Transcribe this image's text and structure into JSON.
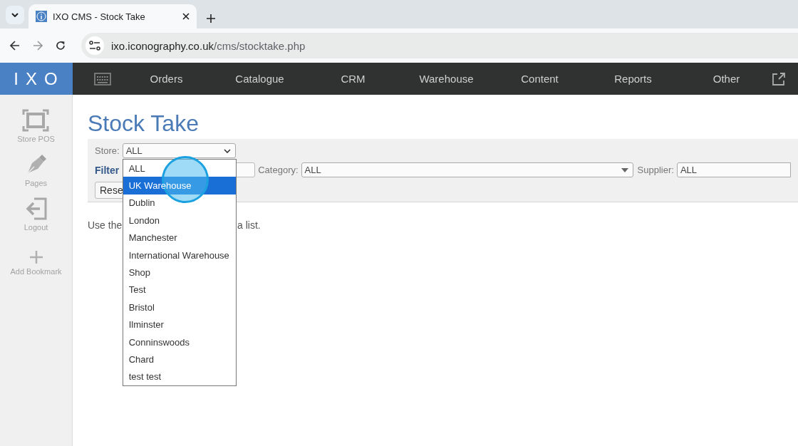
{
  "browser": {
    "tab_title": "IXO CMS - Stock Take",
    "url_host": "ixo.iconography.co.uk",
    "url_path": "/cms/stocktake.php"
  },
  "logo": "IXO",
  "nav": [
    {
      "label": "Orders"
    },
    {
      "label": "Catalogue"
    },
    {
      "label": "CRM"
    },
    {
      "label": "Warehouse"
    },
    {
      "label": "Content"
    },
    {
      "label": "Reports"
    },
    {
      "label": "Other"
    }
  ],
  "sidebar": [
    {
      "label": "Store POS",
      "kind": "frame"
    },
    {
      "label": "Pages",
      "kind": "pen"
    },
    {
      "label": "Logout",
      "kind": "logout"
    },
    {
      "label": "Add Bookmark",
      "kind": "plus"
    }
  ],
  "title": "Stock Take",
  "filters": {
    "store_label": "Store:",
    "store_value": "ALL",
    "filter_label": "Filter",
    "category_label": "Category:",
    "category_value": "ALL",
    "supplier_label": "Supplier:",
    "supplier_value": "ALL",
    "reset_button": "Rese"
  },
  "store_options": [
    {
      "label": "ALL",
      "selected": false
    },
    {
      "label": "UK Warehouse",
      "selected": true
    },
    {
      "label": "Dublin",
      "selected": false
    },
    {
      "label": "London",
      "selected": false
    },
    {
      "label": "Manchester",
      "selected": false
    },
    {
      "label": "International Warehouse",
      "selected": false
    },
    {
      "label": "Shop",
      "selected": false
    },
    {
      "label": "Test",
      "selected": false
    },
    {
      "label": "Bristol",
      "selected": false
    },
    {
      "label": "Ilminster",
      "selected": false
    },
    {
      "label": "Conninswoods",
      "selected": false
    },
    {
      "label": "Chard",
      "selected": false
    },
    {
      "label": "test test",
      "selected": false
    }
  ],
  "hint": [
    "Use the",
    "a list."
  ]
}
